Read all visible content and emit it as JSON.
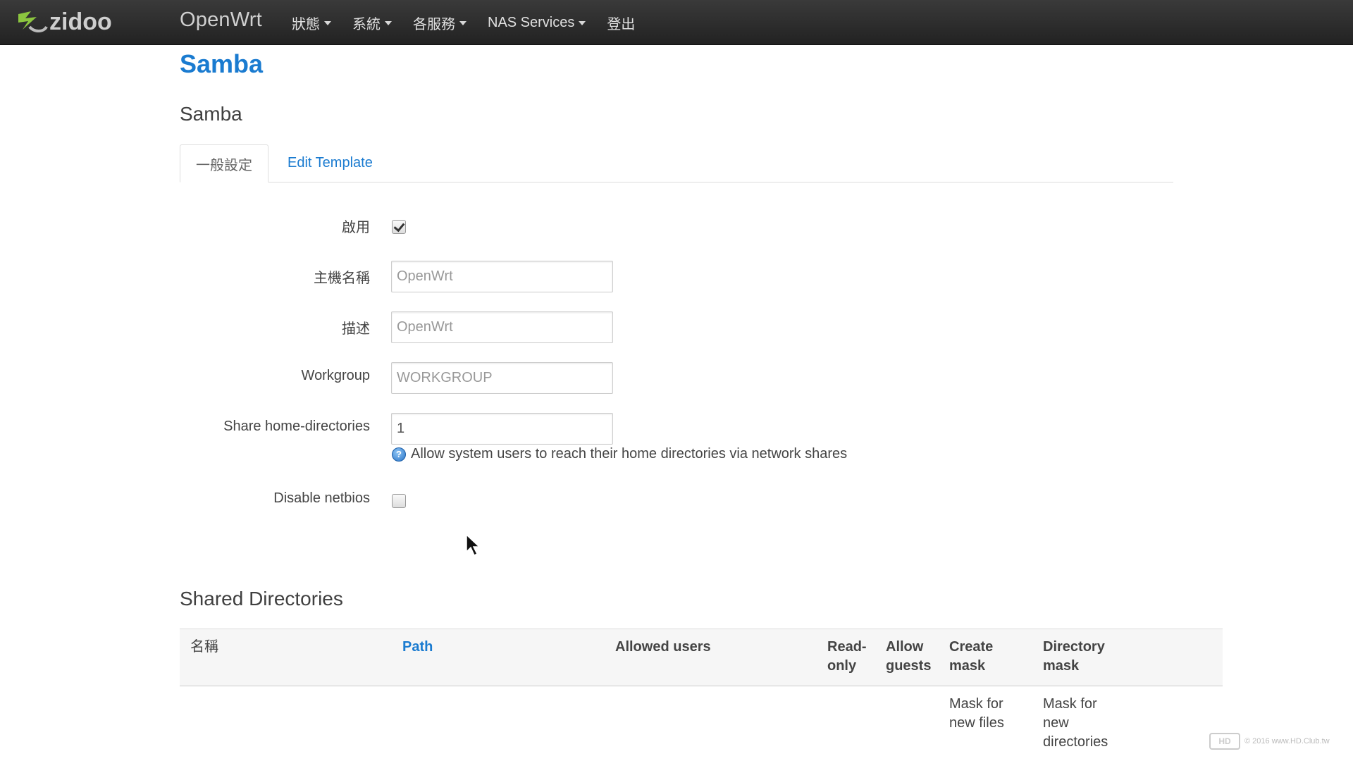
{
  "navbar": {
    "logo_text": "zidoo",
    "brand": "OpenWrt",
    "menu": [
      {
        "label": "狀態",
        "has_caret": true
      },
      {
        "label": "系統",
        "has_caret": true
      },
      {
        "label": "各服務",
        "has_caret": true
      },
      {
        "label": "NAS Services",
        "has_caret": true
      },
      {
        "label": "登出",
        "has_caret": false
      }
    ]
  },
  "page": {
    "title": "Samba",
    "section_title": "Samba"
  },
  "tabs": [
    {
      "label": "一般設定",
      "active": true
    },
    {
      "label": "Edit Template",
      "active": false
    }
  ],
  "form": {
    "enable": {
      "label": "啟用",
      "checked": true
    },
    "hostname": {
      "label": "主機名稱",
      "placeholder": "OpenWrt"
    },
    "description": {
      "label": "描述",
      "placeholder": "OpenWrt"
    },
    "workgroup": {
      "label": "Workgroup",
      "placeholder": "WORKGROUP"
    },
    "share_home": {
      "label": "Share home-directories",
      "value": "1",
      "hint": "Allow system users to reach their home directories via network shares"
    },
    "disable_netbios": {
      "label": "Disable netbios",
      "checked": false
    }
  },
  "shared": {
    "title": "Shared Directories",
    "columns": [
      {
        "line1": "名稱",
        "line2": ""
      },
      {
        "line1": "Path",
        "line2": ""
      },
      {
        "line1": "Allowed users",
        "line2": ""
      },
      {
        "line1": "Read-",
        "line2": "only"
      },
      {
        "line1": "Allow",
        "line2": "guests"
      },
      {
        "line1": "Create",
        "line2": "mask"
      },
      {
        "line1": "Directory",
        "line2": "mask"
      }
    ],
    "descriptions": {
      "create_mask": [
        "Mask for",
        "new files"
      ],
      "directory_mask": [
        "Mask for",
        "new",
        "directories"
      ]
    }
  },
  "watermark": {
    "mark": "HD",
    "text": "© 2016 www.HD.Club.tw"
  },
  "colors": {
    "link": "#1a7bd0",
    "navbar": "#2a2a2a",
    "logo_green": "#8cc63f"
  }
}
